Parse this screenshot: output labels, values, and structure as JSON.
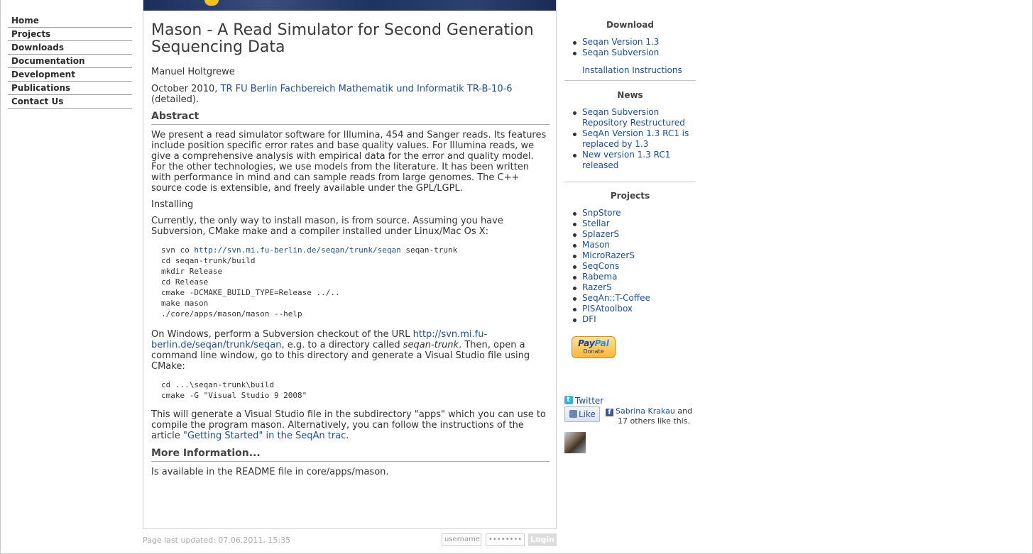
{
  "nav": {
    "items": [
      {
        "label": "Home"
      },
      {
        "label": "Projects"
      },
      {
        "label": "Downloads"
      },
      {
        "label": "Documentation"
      },
      {
        "label": "Development"
      },
      {
        "label": "Publications"
      },
      {
        "label": "Contact Us"
      }
    ]
  },
  "article": {
    "title": "Mason - A Read Simulator for Second Generation Sequencing Data",
    "author": "Manuel Holtgrewe",
    "date_prefix": "October 2010, ",
    "report_link": "TR FU Berlin Fachbereich Mathematik und Informatik TR-B-10-6",
    "date_suffix": " (detailed).",
    "abstract_heading": "Abstract",
    "abstract": "We present a read simulator software for Illumina, 454 and Sanger reads. Its features include position specific error rates and base quality values. For Illumina reads, we give a comprehensive analysis with empirical data for the error and quality model. For the other technologies, we use models from the literature. It has been written with performance in mind and can sample reads from large genomes. The C++ source code is extensible, and freely available under the GPL/LGPL.",
    "installing": "Installing",
    "install_intro": "Currently, the only way to install mason, is from source. Assuming you have Subversion, CMake make and a compiler installed under Linux/Mac Os X:",
    "code1": {
      "svn_prefix": "svn co ",
      "svn_url": "http://svn.mi.fu-berlin.de/seqan/trunk/seqan",
      "svn_suffix": " seqan-trunk",
      "lines": [
        "cd seqan-trunk/build",
        "mkdir Release",
        "cd Release",
        "cmake -DCMAKE_BUILD_TYPE=Release ../..",
        "make mason",
        "./core/apps/mason/mason --help"
      ]
    },
    "win_intro_1": "On Windows, perform a Subversion checkout of the URL ",
    "win_url": "http://svn.mi.fu-berlin.de/seqan/trunk/seqan",
    "win_intro_2": ", e.g. to a directory called ",
    "win_dir": "seqan-trunk",
    "win_intro_3": ". Then, open a command line window, go to this directory and generate a Visual Studio file using CMake:",
    "code2": [
      "cd ...\\seqan-trunk\\build",
      "cmake -G \"Visual Studio 9 2008\""
    ],
    "vs_text": "This will generate a Visual Studio file in the subdirectory \"apps\" which you can use to compile the program mason. Alternatively, you can follow the instructions of the article ",
    "vs_link": "\"Getting Started\" in the SeqAn trac",
    "vs_end": ".",
    "more_heading": "More Information...",
    "readme": "Is available in the README file in core/apps/mason."
  },
  "footer": {
    "updated": "Page last updated: 07.06.2011, 15:35",
    "username_placeholder": "username",
    "password_placeholder": "••••••••",
    "login_label": "Login"
  },
  "sidebar": {
    "download_heading": "Download",
    "downloads": [
      "Seqan Version 1.3",
      "Seqan Subversion"
    ],
    "install_link": "Installation Instructions",
    "news_heading": "News",
    "news": [
      "Seqan Subversion Repository Restructured",
      "SeqAn Version 1.3 RC1 is replaced by 1.3",
      "New version 1.3 RC1 released"
    ],
    "projects_heading": "Projects",
    "projects": [
      "SnpStore",
      "Stellar",
      "SplazerS",
      "Mason",
      "MicroRazerS",
      "SeqCons",
      "Rabema",
      "RazerS",
      "SeqAn::T-Coffee",
      "PISAtoolbox",
      "DFI"
    ],
    "paypal_brand_1": "Pay",
    "paypal_brand_2": "Pal",
    "paypal_donate": "Donate",
    "twitter_label": "Twitter",
    "like_label": "Like",
    "fb_name": "Sabrina Krakau",
    "fb_and": " and",
    "fb_others": "17 others like this."
  }
}
